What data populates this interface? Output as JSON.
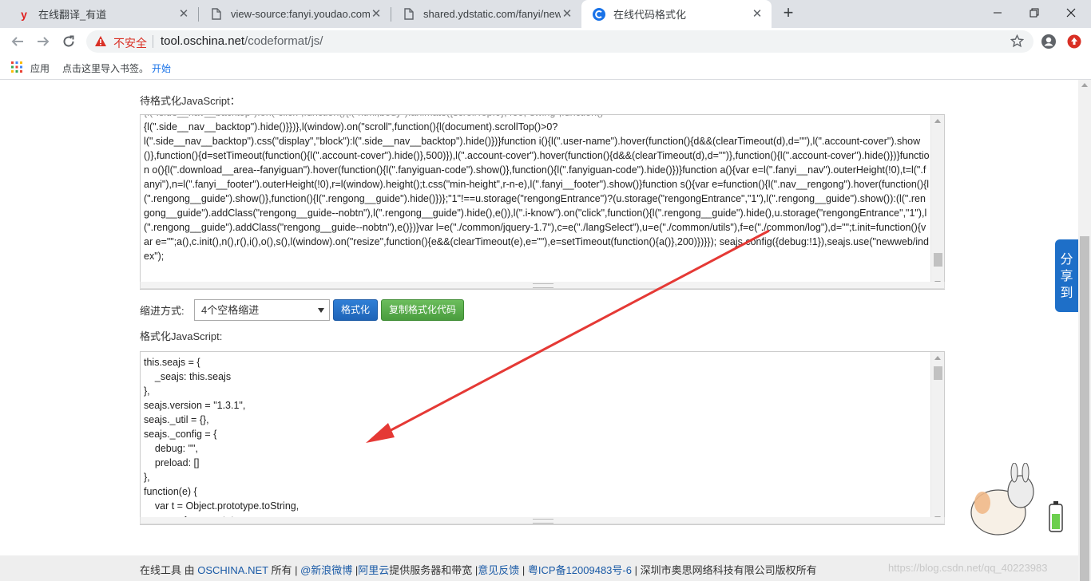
{
  "browser": {
    "tabs": [
      {
        "title": "在线翻译_有道",
        "active": false
      },
      {
        "title": "view-source:fanyi.youdao.com",
        "active": false
      },
      {
        "title": "shared.ydstatic.com/fanyi/new",
        "active": false
      },
      {
        "title": "在线代码格式化",
        "active": true
      }
    ],
    "insecure_label": "不安全",
    "url_host": "tool.oschina.net",
    "url_path": "/codeformat/js/",
    "bookmarks": {
      "apps_label": "应用",
      "hint": "点击这里导入书签。",
      "start_link": "开始"
    }
  },
  "page": {
    "input_label": "待格式化JavaScript：",
    "input_lines": [
      "{l(\".side__nav__backtop\").hide()}})},l(window).on(\"scroll\",function(){l(document).scrollTop()>0?",
      "l(\".side__nav__backtop\").css(\"display\",\"block\"):l(\".side__nav__backtop\").hide()})}function i(){l(\".user-name\").hover(function(){d&&(clearTimeout(d),d=\"\"),l(\".account-cover\").show()},function(){d=setTimeout(function(){l(\".account-cover\").hide()},500)}),l(\".account-cover\").hover(function(){d&&(clearTimeout(d),d=\"\")},function(){l(\".account-cover\").hide()})}function o(){l(\".download__area--fanyiguan\").hover(function(){l(\".fanyiguan-code\").show()},function(){l(\".fanyiguan-code\").hide()})}function a(){var e=l(\".fanyi__nav\").outerHeight(!0),t=l(\".fanyi\"),n=l(\".fanyi__footer\").outerHeight(!0),r=l(window).height();t.css(\"min-height\",r-n-e),l(\".fanyi__footer\").show()}function s(){var e=function(){l(\".nav__rengong\").hover(function(){l(\".rengong__guide\").show()},function(){l(\".rengong__guide\").hide()})};\"1\"!==u.storage(\"rengongEntrance\")?(u.storage(\"rengongEntrance\",\"1\"),l(\".rengong__guide\").show()):(l(\".rengong__guide\").addClass(\"rengong__guide--nobtn\"),l(\".rengong__guide\").hide(),e()),l(\".i-know\").on(\"click\",function(){l(\".rengong__guide\").hide(),u.storage(\"rengongEntrance\",\"1\"),l(\".rengong__guide\").addClass(\"rengong__guide--nobtn\"),e()})}var l=e(\"./common/jquery-1.7\"),c=e(\"./langSelect\"),u=e(\"./common/utils\"),f=e(\"./common/log\"),d=\"\";t.init=function(){var e=\"\";a(),c.init(),n(),r(),i(),o(),s(),l(window).on(\"resize\",function(){e&&(clearTimeout(e),e=\"\"),e=setTimeout(function(){a()},200)})}}); seajs.config({debug:!1}),seajs.use(\"newweb/index\");"
    ],
    "indent_label": "缩进方式:",
    "indent_selected": "4个空格缩进",
    "format_button": "格式化",
    "copy_button": "复制格式化代码",
    "output_label": "格式化JavaScript:",
    "output_code": "this.seajs = {\n    _seajs: this.seajs\n},\nseajs.version = \"1.3.1\",\nseajs._util = {},\nseajs._config = {\n    debug: \"\",\n    preload: []\n},\nfunction(e) {\n    var t = Object.prototype.toString,\n        n = Array.prototype;",
    "footer": {
      "prefix": "在线工具 由 ",
      "oschina": "OSCHINA.NET",
      "owns": " 所有 | ",
      "weibo": "@新浪微博",
      "sep1": " |",
      "aliyun": "阿里云",
      "provides": "提供服务器和带宽 |",
      "feedback": "意见反馈",
      "sep2": " | ",
      "icp": "粤ICP备12009483号-6",
      "copyright": " | 深圳市奥思网络科技有限公司版权所有"
    },
    "watermark": "https://blog.csdn.net/qq_40223983",
    "share_label": "分享到"
  },
  "colors": {
    "accent_blue": "#1e6fc8",
    "arrow_red": "#e53935",
    "insecure_red": "#d93025"
  }
}
